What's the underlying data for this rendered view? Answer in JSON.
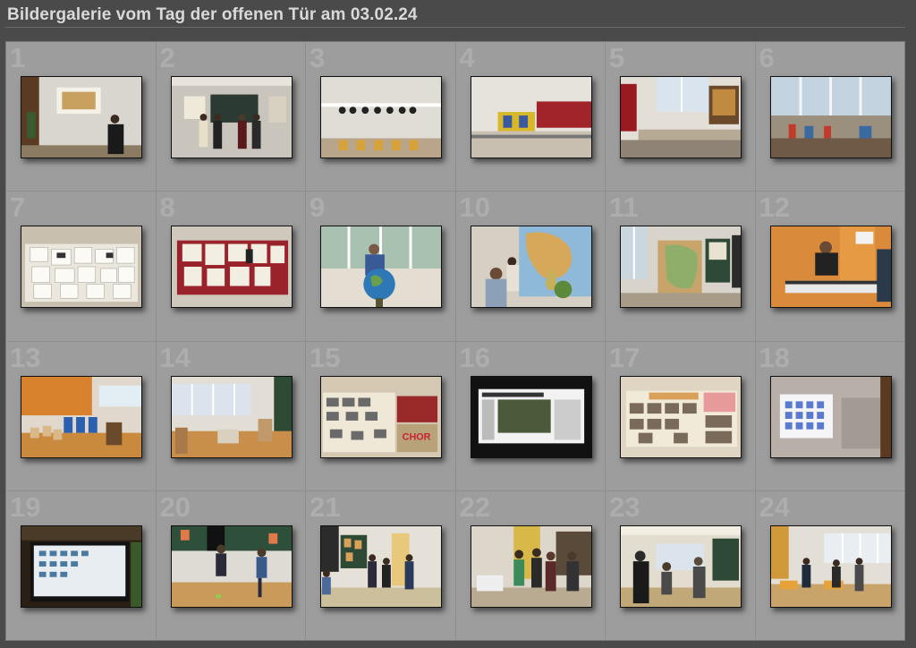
{
  "page": {
    "title": "Bildergalerie vom Tag der offenen Tür am 03.02.24"
  },
  "gallery": {
    "items": [
      {
        "number": "1",
        "scene": "presentation-room"
      },
      {
        "number": "2",
        "scene": "group-board"
      },
      {
        "number": "3",
        "scene": "classroom-hats"
      },
      {
        "number": "4",
        "scene": "lab-room"
      },
      {
        "number": "5",
        "scene": "window-room-exhibit"
      },
      {
        "number": "6",
        "scene": "bright-windows"
      },
      {
        "number": "7",
        "scene": "pinboard-papers"
      },
      {
        "number": "8",
        "scene": "red-pinboard"
      },
      {
        "number": "9",
        "scene": "globe-man"
      },
      {
        "number": "10",
        "scene": "map-kids"
      },
      {
        "number": "11",
        "scene": "map-room"
      },
      {
        "number": "12",
        "scene": "keyboard-player"
      },
      {
        "number": "13",
        "scene": "orange-room-drums"
      },
      {
        "number": "14",
        "scene": "drums-window"
      },
      {
        "number": "15",
        "scene": "chor-board"
      },
      {
        "number": "16",
        "scene": "newspaper-screen"
      },
      {
        "number": "17",
        "scene": "collage-board"
      },
      {
        "number": "18",
        "scene": "projection-wall"
      },
      {
        "number": "19",
        "scene": "screen-desktop"
      },
      {
        "number": "20",
        "scene": "kids-hockey"
      },
      {
        "number": "21",
        "scene": "hall-people"
      },
      {
        "number": "22",
        "scene": "students-group"
      },
      {
        "number": "23",
        "scene": "room-visitors"
      },
      {
        "number": "24",
        "scene": "tables-people"
      }
    ]
  }
}
